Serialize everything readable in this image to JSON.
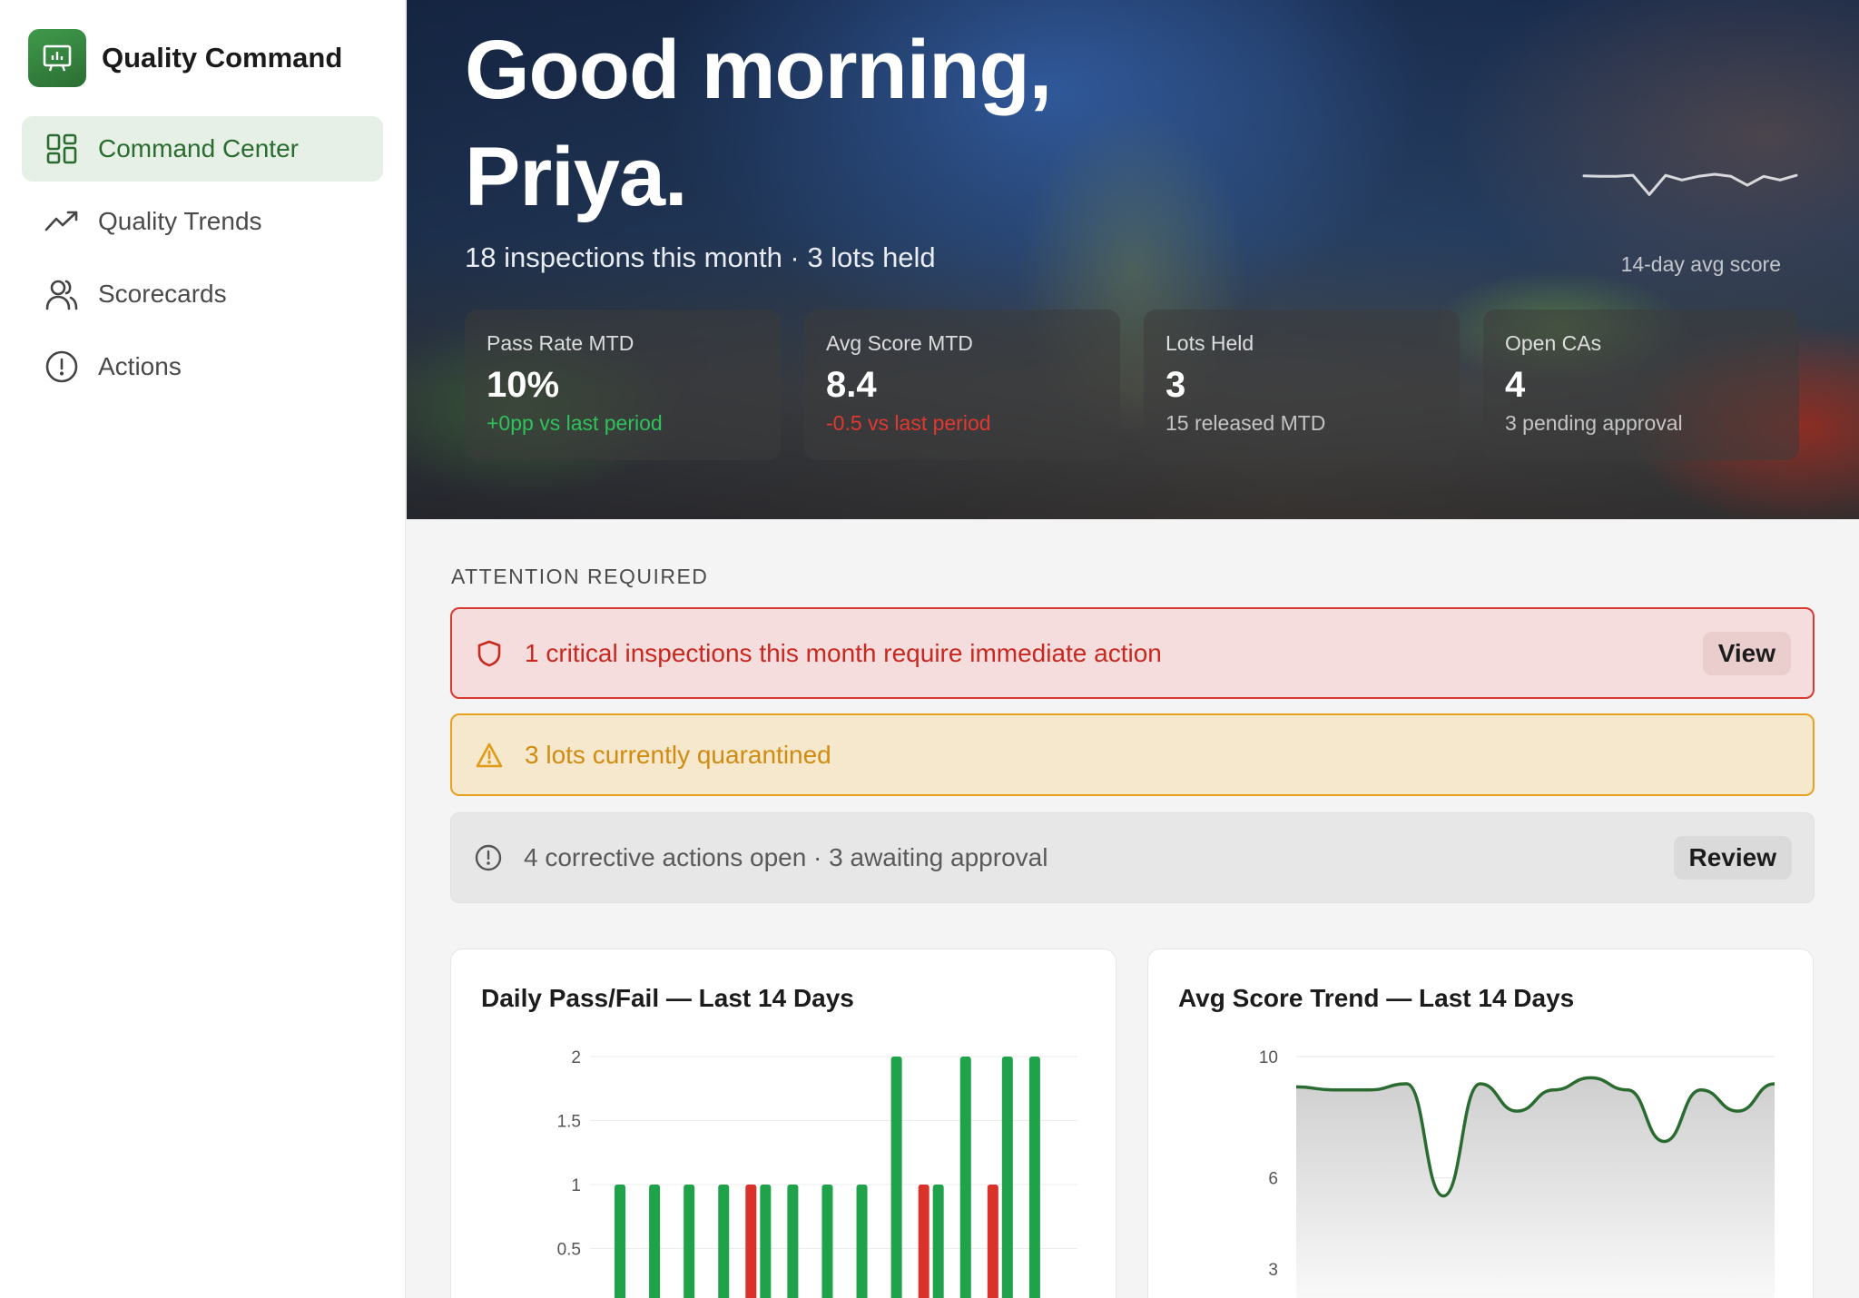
{
  "app": {
    "name": "Quality Command",
    "logo_icon": "presentation-chart-icon"
  },
  "sidebar": {
    "items": [
      {
        "label": "Command Center",
        "icon": "dashboard-grid-icon",
        "active": true
      },
      {
        "label": "Quality Trends",
        "icon": "trending-up-icon",
        "active": false
      },
      {
        "label": "Scorecards",
        "icon": "users-icon",
        "active": false
      },
      {
        "label": "Actions",
        "icon": "alert-circle-icon",
        "active": false
      }
    ]
  },
  "hero": {
    "greeting_line1": "Good morning,",
    "greeting_line2": "Priya.",
    "subtitle": "18 inspections this month · 3 lots held",
    "sparkline_label": "14-day avg score",
    "kpis": [
      {
        "label": "Pass Rate MTD",
        "value": "10%",
        "delta": "+0pp vs last period",
        "tone": "positive"
      },
      {
        "label": "Avg Score MTD",
        "value": "8.4",
        "delta": "-0.5 vs last period",
        "tone": "negative"
      },
      {
        "label": "Lots Held",
        "value": "3",
        "delta": "15 released MTD",
        "tone": "neutral"
      },
      {
        "label": "Open CAs",
        "value": "4",
        "delta": "3 pending approval",
        "tone": "neutral"
      }
    ]
  },
  "attention": {
    "title": "ATTENTION REQUIRED",
    "critical": {
      "text": "1 critical inspections this month require immediate action",
      "button": "View",
      "icon": "shield-icon"
    },
    "warning": {
      "text": "3 lots currently quarantined",
      "icon": "warning-triangle-icon"
    },
    "info": {
      "text": "4 corrective actions open · 3 awaiting approval",
      "button": "Review",
      "icon": "alert-circle-icon"
    }
  },
  "colors": {
    "brand": "#2f7d38",
    "pass": "#1fa24a",
    "fail": "#d8322a",
    "warning": "#e8a020",
    "line": "#2a6b2f"
  },
  "chart_data": [
    {
      "type": "bar",
      "title": "Daily Pass/Fail — Last 14 Days",
      "ylim": [
        0,
        2
      ],
      "yticks": [
        "0.5",
        "1",
        "1.5",
        "2"
      ],
      "grid": true,
      "series": [
        {
          "values": [
            1,
            1,
            1,
            1,
            1,
            1,
            1,
            1,
            2,
            1,
            2,
            2,
            2,
            0
          ],
          "color": "#1fa24a"
        },
        {
          "values": [
            0,
            0,
            0,
            0,
            1,
            0,
            0,
            0,
            0,
            1,
            0,
            1,
            0,
            0
          ],
          "color": "#d8322a"
        }
      ]
    },
    {
      "type": "area",
      "title": "Avg Score Trend — Last 14 Days",
      "ylim": [
        0,
        10
      ],
      "yticks": [
        "3",
        "6",
        "10"
      ],
      "grid": true,
      "values": [
        9.0,
        8.9,
        8.9,
        9.1,
        5.4,
        9.1,
        8.2,
        8.9,
        9.3,
        8.9,
        7.2,
        8.9,
        8.2,
        9.1
      ]
    }
  ]
}
